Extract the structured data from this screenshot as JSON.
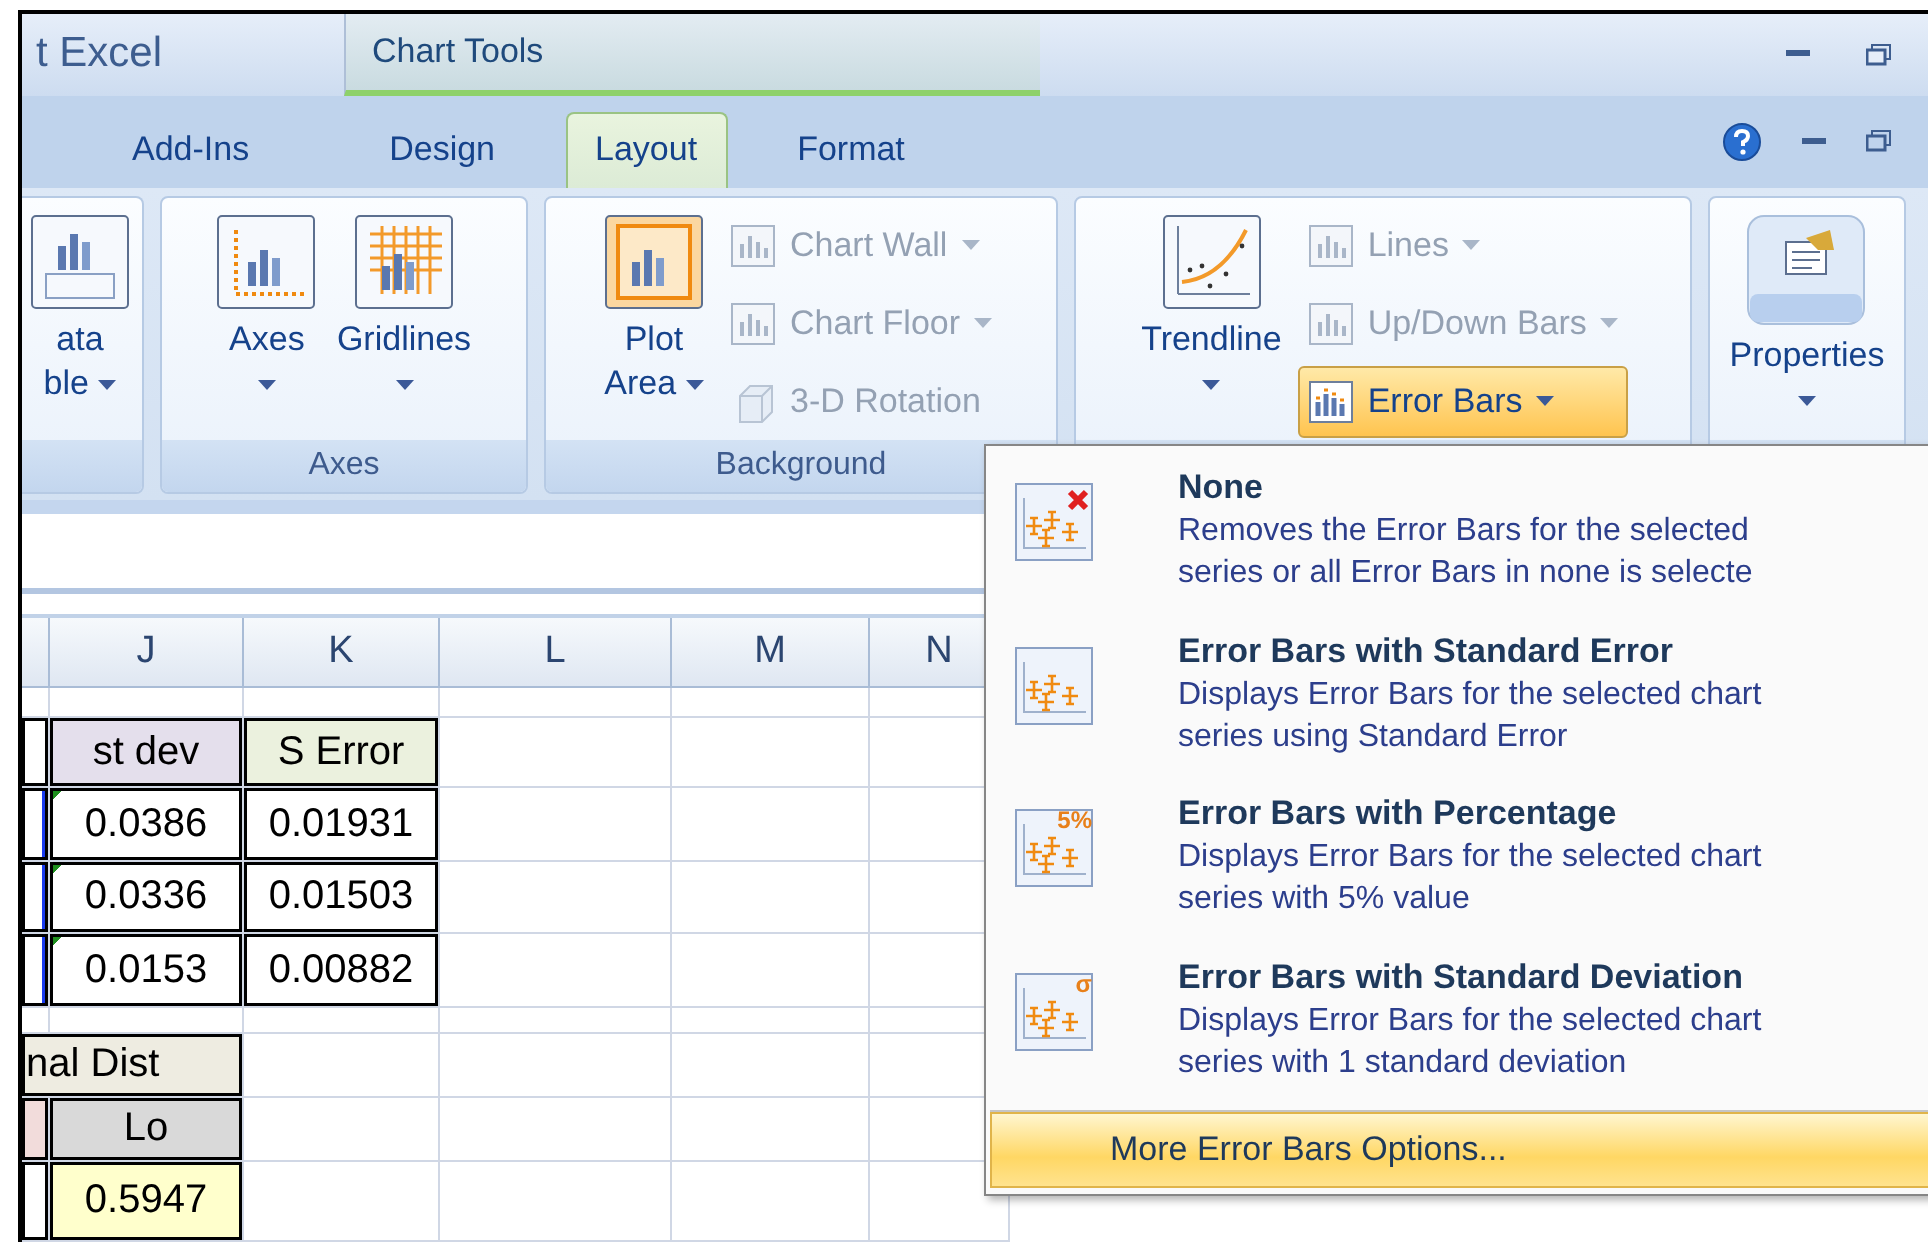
{
  "title_bar": {
    "app_title": "t Excel",
    "context_group": "Chart Tools"
  },
  "tabs": [
    {
      "label": "Add-Ins",
      "selected": false
    },
    {
      "label": "Design",
      "selected": false
    },
    {
      "label": "Layout",
      "selected": true
    },
    {
      "label": "Format",
      "selected": false
    }
  ],
  "ribbon": {
    "groups": [
      {
        "items": [
          {
            "kind": "large",
            "lines": [
              "ata",
              "ble"
            ],
            "dropdown": true,
            "disabled": false
          }
        ]
      },
      {
        "label": "Axes",
        "items": [
          {
            "kind": "large",
            "lines": [
              "Axes"
            ],
            "dropdown": true,
            "disabled": false
          },
          {
            "kind": "large",
            "lines": [
              "Gridlines"
            ],
            "dropdown": true,
            "disabled": false
          }
        ]
      },
      {
        "label": "Background",
        "items": [
          {
            "kind": "large",
            "lines": [
              "Plot",
              "Area"
            ],
            "dropdown": true,
            "disabled": false
          },
          {
            "kind": "small",
            "label": "Chart Wall",
            "dropdown": true,
            "disabled": true,
            "active": false
          },
          {
            "kind": "small",
            "label": "Chart Floor",
            "dropdown": true,
            "disabled": true,
            "active": false
          },
          {
            "kind": "small",
            "label": "3-D Rotation",
            "dropdown": false,
            "disabled": true,
            "active": false
          }
        ]
      },
      {
        "items": [
          {
            "kind": "large",
            "lines": [
              "Trendline"
            ],
            "dropdown": true,
            "disabled": false
          },
          {
            "kind": "small",
            "label": "Lines",
            "dropdown": true,
            "disabled": true,
            "active": false
          },
          {
            "kind": "small",
            "label": "Up/Down Bars",
            "dropdown": true,
            "disabled": true,
            "active": false
          },
          {
            "kind": "small",
            "label": "Error Bars",
            "dropdown": true,
            "disabled": false,
            "active": true
          }
        ]
      },
      {
        "items": [
          {
            "kind": "large",
            "lines": [
              "Properties"
            ],
            "dropdown": true,
            "disabled": false
          }
        ]
      }
    ]
  },
  "sheet": {
    "columns": [
      "",
      "J",
      "K",
      "L",
      "M",
      "N"
    ],
    "rows": [
      {
        "cells": [
          {
            "bordered": true
          },
          {
            "text": "st dev",
            "color": "#e4dfec",
            "bordered": true
          },
          {
            "text": "S Error",
            "color": "#ebf1de",
            "bordered": true
          }
        ]
      },
      {
        "cells": [
          {
            "bordered": true,
            "in_selection": true
          },
          {
            "text": "0.0386",
            "bordered": true,
            "error_flag": true
          },
          {
            "text": "0.01931",
            "bordered": true
          }
        ]
      },
      {
        "cells": [
          {
            "bordered": true,
            "in_selection": true
          },
          {
            "text": "0.0336",
            "bordered": true,
            "error_flag": true
          },
          {
            "text": "0.01503",
            "bordered": true
          }
        ]
      },
      {
        "cells": [
          {
            "bordered": true,
            "in_selection": true
          },
          {
            "text": "0.0153",
            "bordered": true,
            "error_flag": true
          },
          {
            "text": "0.00882",
            "bordered": true
          }
        ]
      },
      {
        "cells": [
          {
            "text": "nal Dist",
            "color": "#eeece1",
            "bordered": true,
            "merged": true
          }
        ]
      },
      {
        "cells": [
          {
            "color": "#f2dcdb",
            "bordered": true
          },
          {
            "text": "Lo",
            "color": "#d9d9d9",
            "bordered": true
          }
        ]
      },
      {
        "cells": [
          {
            "bordered": true
          },
          {
            "text": "0.5947",
            "color": "#ffffcc",
            "bordered": true
          }
        ]
      }
    ]
  },
  "menu": {
    "items": [
      {
        "kind": "remove",
        "title": "None",
        "description_lines": [
          "Removes the Error Bars for the selected",
          "series or all Error Bars in none is selecte"
        ]
      },
      {
        "kind": "error",
        "title": "Error Bars with Standard Error",
        "description_lines": [
          "Displays Error Bars for the selected chart",
          "series using Standard Error"
        ]
      },
      {
        "kind": "percent",
        "icon_mark": "5%",
        "title": "Error Bars with Percentage",
        "description_lines": [
          "Displays Error Bars for the selected chart",
          "series with 5% value"
        ]
      },
      {
        "kind": "deviation",
        "icon_mark": "σ",
        "title": "Error Bars with Standard Deviation",
        "description_lines": [
          "Displays Error Bars for the selected chart",
          "series with 1 standard deviation"
        ]
      }
    ],
    "footer": {
      "label": "More Error Bars Options...",
      "highlighted": true
    }
  }
}
